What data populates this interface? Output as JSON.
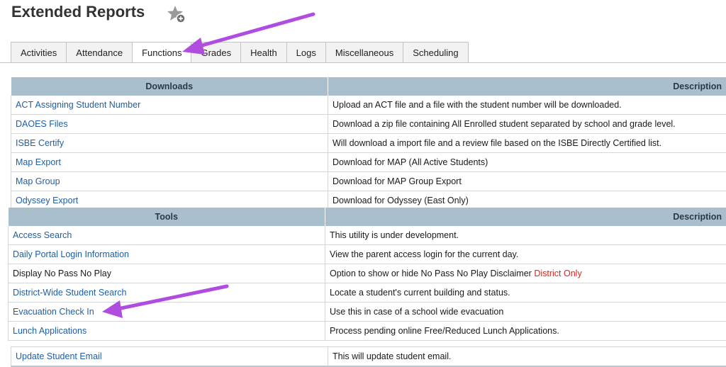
{
  "page": {
    "title": "Extended Reports"
  },
  "tabs": [
    "Activities",
    "Attendance",
    "Functions",
    "Grades",
    "Health",
    "Logs",
    "Miscellaneous",
    "Scheduling"
  ],
  "active_tab": "Functions",
  "downloads": {
    "header_name": "Downloads",
    "header_desc": "Description",
    "rows": [
      {
        "name": "ACT Assigning Student Number",
        "desc": "Upload an ACT file and a file with the student number will be downloaded."
      },
      {
        "name": "DAOES Files",
        "desc": "Download a zip file containing All Enrolled student separated by school and grade level."
      },
      {
        "name": "ISBE Certify",
        "desc": "Will download a import file and a review file based on the ISBE Directly Certified list."
      },
      {
        "name": "Map Export",
        "desc": "Download for MAP (All Active Students)"
      },
      {
        "name": "Map Group",
        "desc": "Download for MAP Group Export"
      },
      {
        "name": "Odyssey Export",
        "desc": "Download for Odyssey (East Only)"
      }
    ]
  },
  "tools": {
    "header_name": "Tools",
    "header_desc": "Description",
    "rows": [
      {
        "name": "Access Search",
        "desc": "This utility is under development.",
        "link": true
      },
      {
        "name": "Daily Portal Login Information",
        "desc": "View the parent access login for the current day.",
        "link": true
      },
      {
        "name": "Display No Pass No Play",
        "desc": "Option to show or hide No Pass No Play Disclaimer",
        "note": "District Only",
        "link": false
      },
      {
        "name": "District-Wide Student Search",
        "desc": "Locate a student's current building and status.",
        "link": true
      },
      {
        "name": "Evacuation Check In",
        "desc": "Use this in case of a school wide evacuation",
        "link": true
      },
      {
        "name": "Lunch Applications",
        "desc": "Process pending online Free/Reduced Lunch Applications.",
        "link": true
      }
    ]
  },
  "extra_row": {
    "name": "Update Student Email",
    "desc": "This will update student email."
  },
  "colors": {
    "header_bg": "#a9bfcd",
    "link": "#1f5fa5",
    "annotation_arrow": "#b04ce0",
    "note": "#e0241b"
  }
}
